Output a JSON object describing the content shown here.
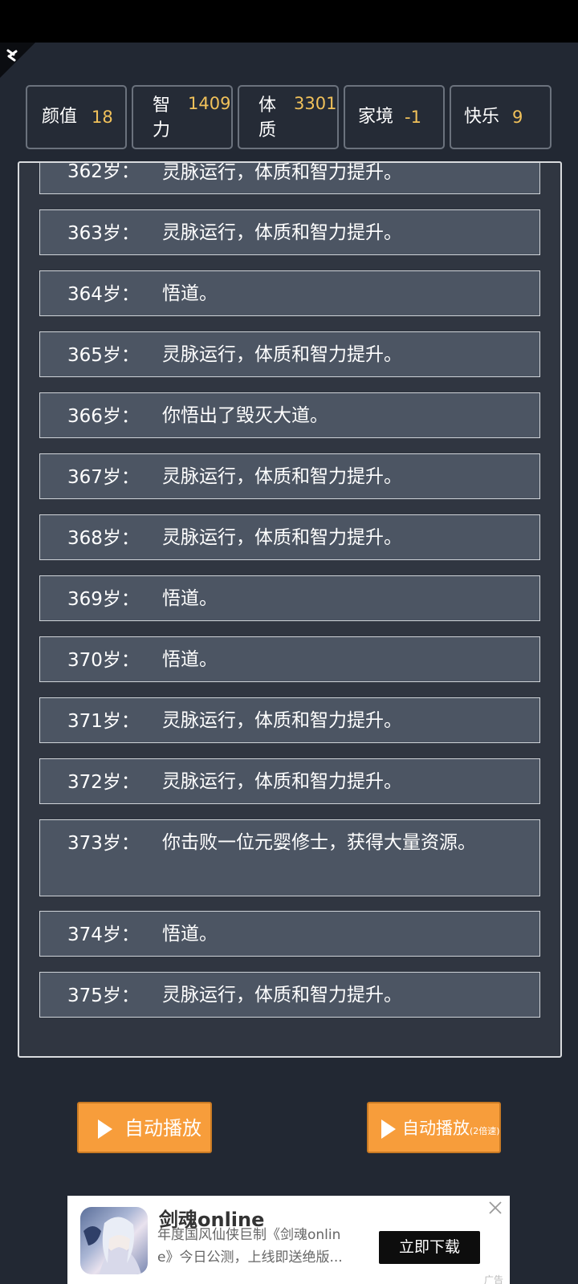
{
  "stats": [
    {
      "label": "颜值",
      "value": "18"
    },
    {
      "label": "智力",
      "value": "1409"
    },
    {
      "label": "体质",
      "value": "3301"
    },
    {
      "label": "家境",
      "value": "-1"
    },
    {
      "label": "快乐",
      "value": "9"
    }
  ],
  "log": [
    {
      "age": "362岁：",
      "text": "灵脉运行，体质和智力提升。"
    },
    {
      "age": "363岁：",
      "text": "灵脉运行，体质和智力提升。"
    },
    {
      "age": "364岁：",
      "text": "悟道。"
    },
    {
      "age": "365岁：",
      "text": "灵脉运行，体质和智力提升。"
    },
    {
      "age": "366岁：",
      "text": "你悟出了毁灭大道。"
    },
    {
      "age": "367岁：",
      "text": "灵脉运行，体质和智力提升。"
    },
    {
      "age": "368岁：",
      "text": "灵脉运行，体质和智力提升。"
    },
    {
      "age": "369岁：",
      "text": "悟道。"
    },
    {
      "age": "370岁：",
      "text": "悟道。"
    },
    {
      "age": "371岁：",
      "text": "灵脉运行，体质和智力提升。"
    },
    {
      "age": "372岁：",
      "text": "灵脉运行，体质和智力提升。"
    },
    {
      "age": "373岁：",
      "text": "你击败一位元婴修士，获得大量资源。"
    },
    {
      "age": "374岁：",
      "text": "悟道。"
    },
    {
      "age": "375岁：",
      "text": "灵脉运行，体质和智力提升。"
    }
  ],
  "buttons": {
    "auto_play": "自动播放",
    "auto_play_fast": "自动播放",
    "auto_play_fast_sub": "(2倍速)"
  },
  "ad": {
    "title": "剑魂online",
    "description": "年度国风仙侠巨制《剑魂online》今日公测，上线即送绝版...",
    "cta": "立即下载",
    "tag": "广告"
  },
  "colors": {
    "background": "#222833",
    "panel": "#303641",
    "row": "#4c5563",
    "stat_value": "#f1c15a",
    "button": "#f79d3b"
  },
  "icons": {
    "corner": "fullscreen-icon",
    "play": "play-icon",
    "close": "close-icon"
  }
}
